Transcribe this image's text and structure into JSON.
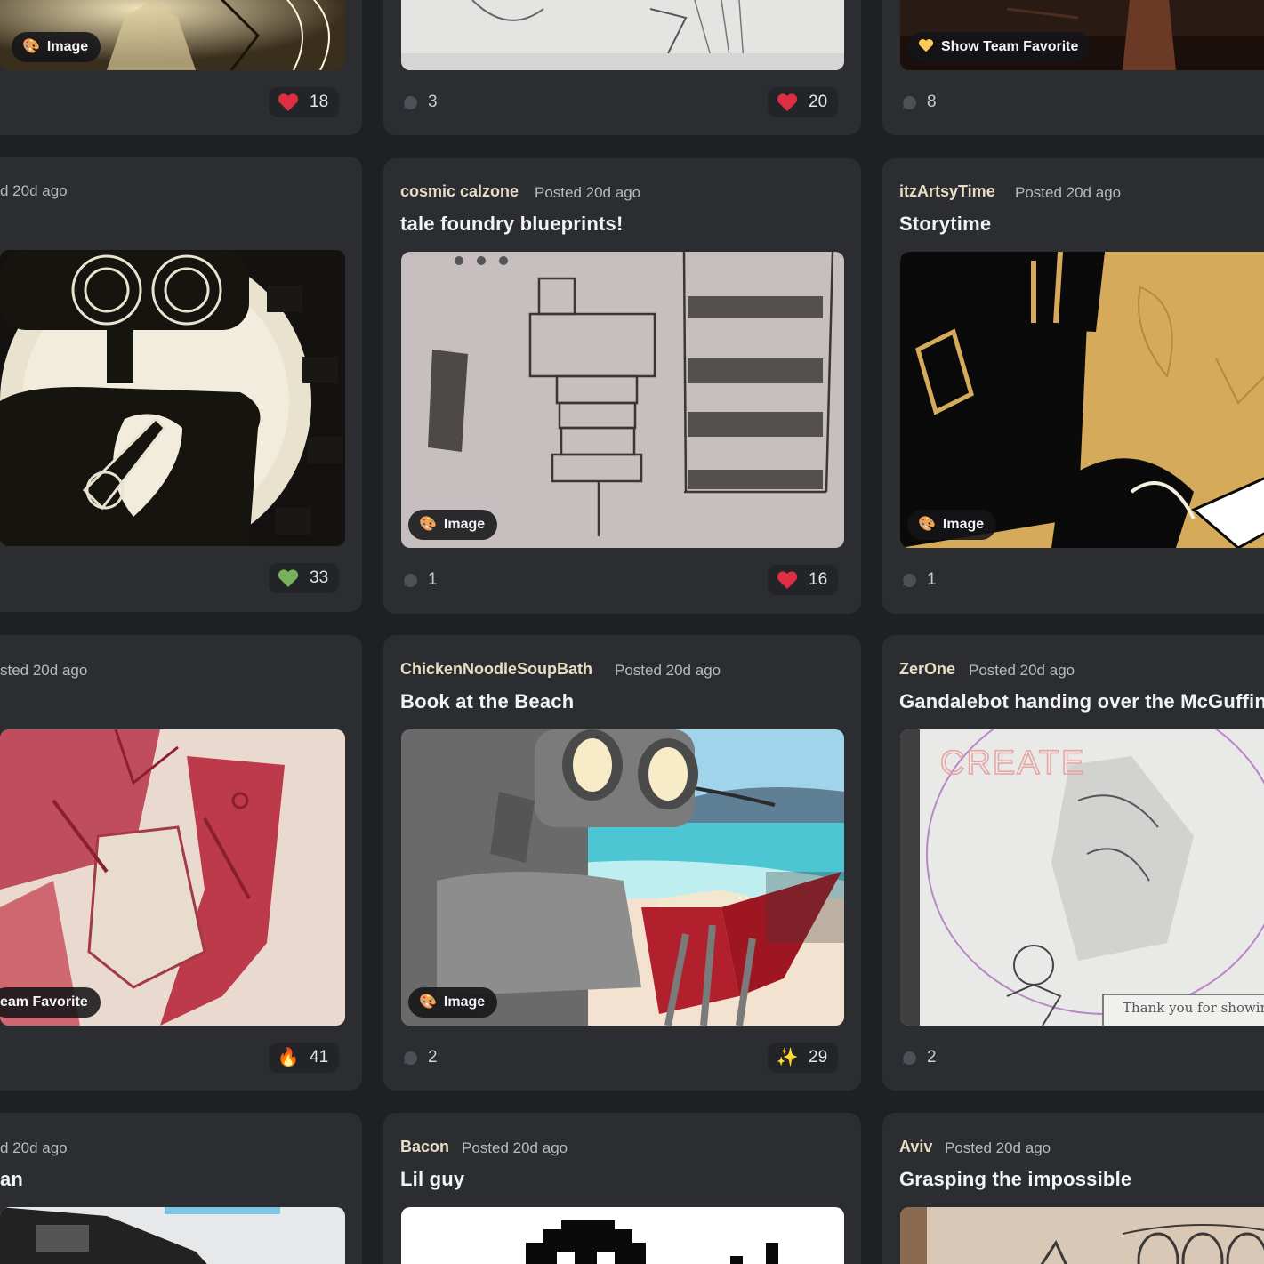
{
  "row0": {
    "left": {
      "badge": "Image",
      "reaction": "18"
    },
    "mid": {
      "comments": "3",
      "reaction": "20"
    },
    "right": {
      "badge": "Show Team Favorite",
      "comments": "8"
    }
  },
  "row1": {
    "left": {
      "posted": "d 20d ago",
      "reaction": "33"
    },
    "mid": {
      "author": "cosmic calzone",
      "posted": "Posted 20d ago",
      "title": "tale foundry blueprints!",
      "badge": "Image",
      "comments": "1",
      "reaction": "16"
    },
    "right": {
      "author": "itzArtsyTime",
      "posted": "Posted 20d ago",
      "title": "Storytime",
      "badge": "Image",
      "comments": "1"
    }
  },
  "row2": {
    "left": {
      "posted": "sted 20d ago",
      "badge": "eam Favorite",
      "reaction": "41"
    },
    "mid": {
      "author": "ChickenNoodleSoupBath",
      "posted": "Posted 20d ago",
      "title": "Book at the Beach",
      "badge": "Image",
      "comments": "2",
      "reaction": "29"
    },
    "right": {
      "author": "ZerOne",
      "posted": "Posted 20d ago",
      "title": "Gandalebot handing over the McGuffin",
      "comments": "2",
      "art_text_top": "CREATE",
      "art_text_bottom": "Thank you for showing me the"
    }
  },
  "row3": {
    "left": {
      "posted": "d 20d ago",
      "title": "an"
    },
    "mid": {
      "author": "Bacon",
      "posted": "Posted 20d ago",
      "title": "Lil guy"
    },
    "right": {
      "author": "Aviv",
      "posted": "Posted 20d ago",
      "title": "Grasping the impossible"
    }
  },
  "icons": {
    "image_badge": "palette-icon",
    "favorite_badge": "yellow-heart-icon",
    "comment": "speech-bubble-icon",
    "reactions": [
      "red-heart-icon",
      "green-heart-icon",
      "fire-icon",
      "sparkles-icon"
    ]
  },
  "colors": {
    "background": "#1f2023",
    "card": "#2b2d31",
    "author": "#e7dcc4",
    "title": "#f2f3f5",
    "muted": "#b6b9bf"
  }
}
